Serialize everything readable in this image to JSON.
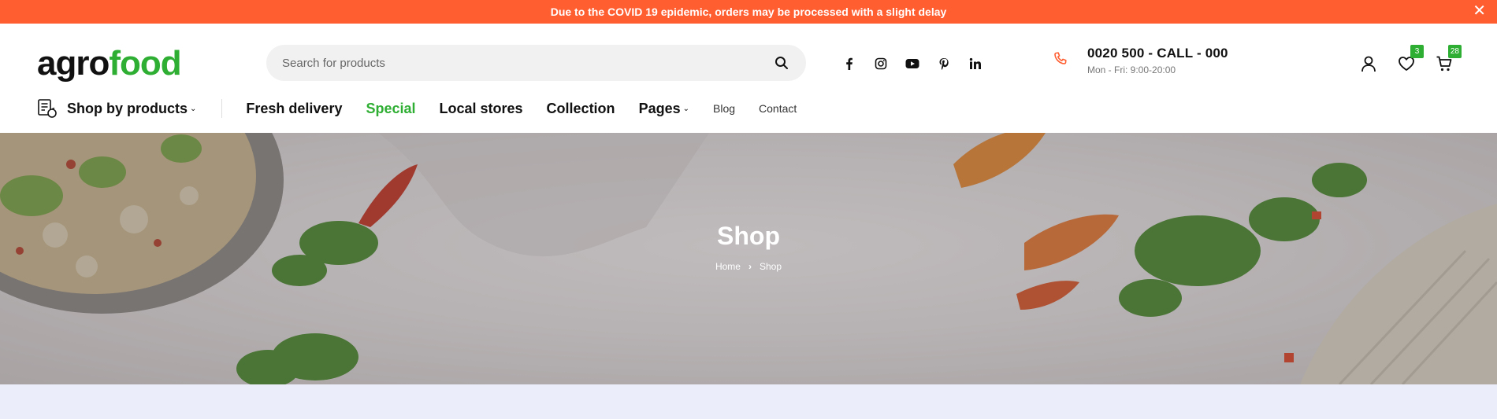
{
  "announcement": {
    "text": "Due to the COVID 19 epidemic, orders may be processed with a slight delay",
    "close": "✕"
  },
  "logo": {
    "part1": "agro",
    "part2": "food"
  },
  "search": {
    "placeholder": "Search for products",
    "value": ""
  },
  "social": [
    "facebook-icon",
    "instagram-icon",
    "youtube-icon",
    "pinterest-icon",
    "linkedin-icon"
  ],
  "contact": {
    "phone": "0020 500 - CALL - 000",
    "hours": "Mon - Fri: 9:00-20:00"
  },
  "user_icons": {
    "wishlist_count": "3",
    "cart_count": "28"
  },
  "nav": {
    "shop_by": "Shop by products",
    "fresh": "Fresh delivery",
    "special": "Special",
    "local": "Local stores",
    "collection": "Collection",
    "pages": "Pages",
    "blog": "Blog",
    "contact": "Contact"
  },
  "hero": {
    "title": "Shop",
    "breadcrumb_home": "Home",
    "breadcrumb_sep": "›",
    "breadcrumb_current": "Shop"
  },
  "colors": {
    "accent_orange": "#ff5e31",
    "brand_green": "#2eae32"
  }
}
